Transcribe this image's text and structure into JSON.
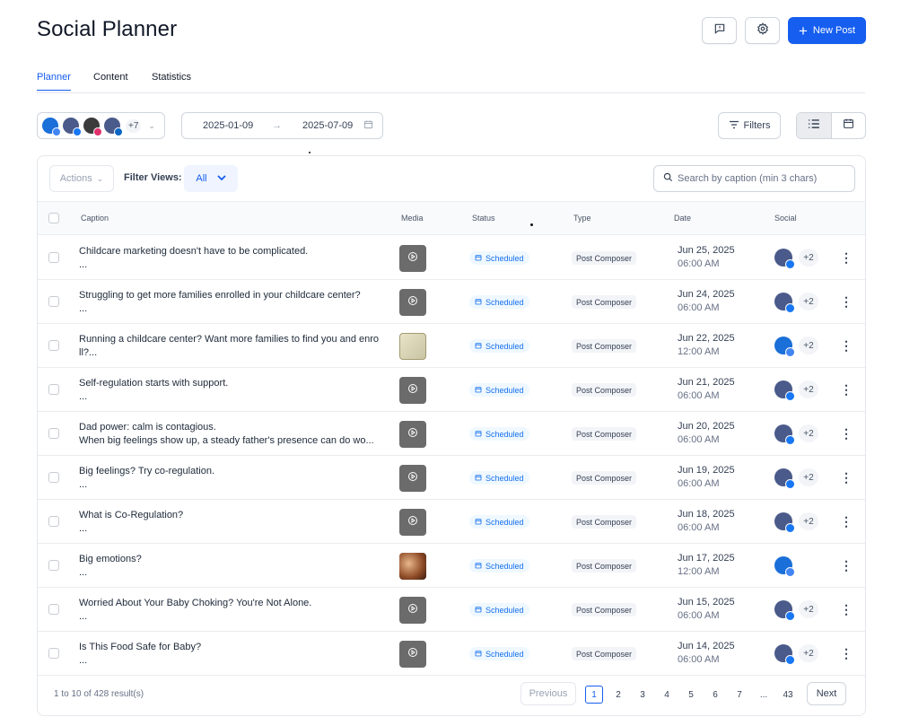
{
  "header": {
    "title": "Social Planner",
    "new_post_label": "New Post"
  },
  "tabs": [
    {
      "label": "Planner",
      "active": true
    },
    {
      "label": "Content",
      "active": false
    },
    {
      "label": "Statistics",
      "active": false
    }
  ],
  "toolbar": {
    "accounts_more": "+7",
    "date_start": "2025-01-09",
    "date_end": "2025-07-09",
    "filters_label": "Filters"
  },
  "table_controls": {
    "actions_label": "Actions",
    "filter_views_label": "Filter Views:",
    "filter_view_value": "All",
    "search_placeholder": "Search by caption (min 3 chars)"
  },
  "columns": [
    "Caption",
    "Media",
    "Status",
    "Type",
    "Date",
    "Social"
  ],
  "rows": [
    {
      "caption_1": "Childcare marketing doesn't have to be complicated.",
      "caption_2": "...",
      "media": "video",
      "status": "Scheduled",
      "type": "Post Composer",
      "date": "Jun 25, 2025",
      "time": "06:00 AM",
      "social": "facebook",
      "more": "+2"
    },
    {
      "caption_1": "Struggling to get more families enrolled in your childcare center?",
      "caption_2": "...",
      "media": "video",
      "status": "Scheduled",
      "type": "Post Composer",
      "date": "Jun 24, 2025",
      "time": "06:00 AM",
      "social": "facebook",
      "more": "+2"
    },
    {
      "caption_1": "Running a childcare center? Want more families to find you and enro",
      "caption_2": "ll?...",
      "media": "image-poster",
      "status": "Scheduled",
      "type": "Post Composer",
      "date": "Jun 22, 2025",
      "time": "12:00 AM",
      "social": "gbp",
      "more": "+2"
    },
    {
      "caption_1": "Self-regulation starts with support.",
      "caption_2": "...",
      "media": "video",
      "status": "Scheduled",
      "type": "Post Composer",
      "date": "Jun 21, 2025",
      "time": "06:00 AM",
      "social": "facebook",
      "more": "+2"
    },
    {
      "caption_1": "Dad power: calm is contagious.",
      "caption_2": "When big feelings show up, a steady father's presence can do wo...",
      "media": "video",
      "status": "Scheduled",
      "type": "Post Composer",
      "date": "Jun 20, 2025",
      "time": "06:00 AM",
      "social": "facebook",
      "more": "+2"
    },
    {
      "caption_1": "Big feelings? Try co-regulation.",
      "caption_2": "...",
      "media": "video",
      "status": "Scheduled",
      "type": "Post Composer",
      "date": "Jun 19, 2025",
      "time": "06:00 AM",
      "social": "facebook",
      "more": "+2"
    },
    {
      "caption_1": "What is Co-Regulation?",
      "caption_2": "...",
      "media": "video",
      "status": "Scheduled",
      "type": "Post Composer",
      "date": "Jun 18, 2025",
      "time": "06:00 AM",
      "social": "facebook",
      "more": "+2"
    },
    {
      "caption_1": "Big emotions?",
      "caption_2": "...",
      "media": "image-photo",
      "status": "Scheduled",
      "type": "Post Composer",
      "date": "Jun 17, 2025",
      "time": "12:00 AM",
      "social": "gbp",
      "more": ""
    },
    {
      "caption_1": "Worried About Your Baby Choking? You're Not Alone.",
      "caption_2": "...",
      "media": "video",
      "status": "Scheduled",
      "type": "Post Composer",
      "date": "Jun 15, 2025",
      "time": "06:00 AM",
      "social": "facebook",
      "more": "+2"
    },
    {
      "caption_1": "Is This Food Safe for Baby?",
      "caption_2": "...",
      "media": "video",
      "status": "Scheduled",
      "type": "Post Composer",
      "date": "Jun 14, 2025",
      "time": "06:00 AM",
      "social": "facebook",
      "more": "+2"
    }
  ],
  "pagination": {
    "summary": "1 to 10 of 428 result(s)",
    "previous_label": "Previous",
    "next_label": "Next",
    "pages": [
      "1",
      "2",
      "3",
      "4",
      "5",
      "6",
      "7",
      "...",
      "43"
    ],
    "current": "1"
  },
  "colors": {
    "accent": "#155eef",
    "status_bg": "#eff8ff",
    "status_text": "#1570ef",
    "facebook": "#1877f2",
    "instagram": "#e1306c",
    "linkedin": "#0a66c2"
  }
}
